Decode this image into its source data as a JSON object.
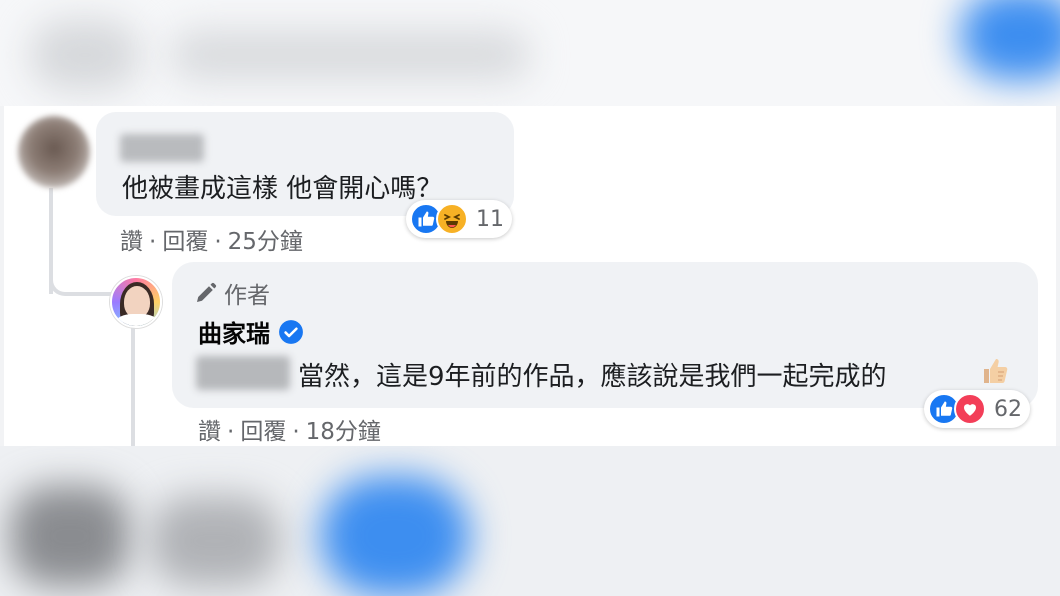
{
  "comment1": {
    "text": "他被畫成這樣 他會開心嗎？",
    "actions": {
      "like": "讚",
      "reply": "回覆",
      "time": "25分鐘"
    },
    "reactions": {
      "icons": [
        "like-icon",
        "haha-icon"
      ],
      "count": "11"
    }
  },
  "comment2": {
    "author_badge": "作者",
    "name": "曲家瑞",
    "text": "當然，這是9年前的作品，應該說是我們一起完成的",
    "actions": {
      "like": "讚",
      "reply": "回覆",
      "time": "18分鐘"
    },
    "reactions": {
      "icons": [
        "like-icon",
        "love-icon"
      ],
      "count": "62"
    }
  },
  "actions_separator": "·",
  "colors": {
    "like_blue": "#1877f2",
    "haha_yellow": "#f7b125",
    "love_red": "#f33e58",
    "bubble_bg": "#f0f2f5",
    "secondary_text": "#65676b",
    "verified_blue": "#1877f2"
  }
}
